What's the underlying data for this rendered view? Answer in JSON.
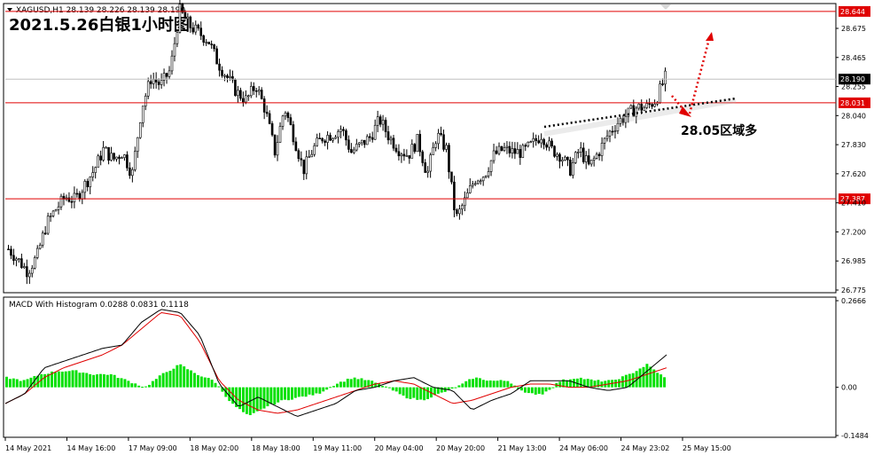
{
  "window": {
    "symbol_info": "XAGUSD,H1  28.139 28.226 28.139 28.190",
    "title": "2021.5.26白银1小时图"
  },
  "colors": {
    "background": "#ffffff",
    "candle": "#000000",
    "hline": "#e00000",
    "label_bg": "#e00000",
    "label_text": "#ffffff",
    "price_line": "#c0c0c0",
    "histogram": "#00e000",
    "macd_line": "#000000",
    "signal_line": "#e00000",
    "arrow": "#e00000",
    "grid_border": "#000000"
  },
  "annotation": {
    "text": "28.05区域多"
  },
  "chart_data": [
    {
      "type": "candlestick",
      "symbol": "XAGUSD",
      "timeframe": "H1",
      "title": "2021.5.26白银1小时图",
      "ylim": [
        26.775,
        28.685
      ],
      "y_ticks": [
        "28.675",
        "28.465",
        "28.255",
        "28.040",
        "27.830",
        "27.620",
        "27.410",
        "27.200",
        "26.985",
        "26.775"
      ],
      "x_ticks": [
        "14 May 2021",
        "14 May 16:00",
        "17 May 09:00",
        "18 May 02:00",
        "18 May 18:00",
        "19 May 11:00",
        "20 May 04:00",
        "20 May 20:00",
        "21 May 13:00",
        "24 May 06:00",
        "24 May 23:02",
        "25 May 15:00"
      ],
      "current_price": "28.190",
      "horizontal_levels": [
        {
          "label": "28.644",
          "value": 28.644
        },
        {
          "label": "28.031",
          "value": 28.031
        },
        {
          "label": "27.387",
          "value": 27.387
        }
      ],
      "trendline": {
        "from_value": 27.87,
        "to_value": 28.06,
        "style": "dotted"
      },
      "waypoints": [
        27.05,
        26.98,
        26.9,
        27.0,
        27.22,
        27.32,
        27.4,
        27.38,
        27.48,
        27.58,
        27.72,
        27.65,
        27.7,
        27.55,
        28.0,
        28.2,
        28.15,
        28.25,
        28.65,
        28.55,
        28.5,
        28.45,
        28.3,
        28.2,
        28.1,
        28.05,
        28.15,
        27.98,
        27.7,
        28.0,
        27.8,
        27.58,
        27.72,
        27.8,
        27.82,
        27.86,
        27.7,
        27.75,
        27.8,
        27.92,
        27.8,
        27.72,
        27.68,
        27.78,
        27.55,
        27.82,
        27.72,
        27.25,
        27.38,
        27.52,
        27.55,
        27.68,
        27.72,
        27.7,
        27.7,
        27.75,
        27.82,
        27.72,
        27.68,
        27.58,
        27.72,
        27.6,
        27.7,
        27.82,
        27.9,
        27.95,
        28.0,
        28.0,
        28.05,
        28.2
      ]
    },
    {
      "type": "macd",
      "title": "MACD With Histogram 0.0288 0.0831 0.1118",
      "ylim": [
        -0.1484,
        0.2666
      ],
      "y_ticks": [
        "0.2666",
        "0.00",
        "-0.1484"
      ],
      "histogram_waypoints": [
        0.03,
        0.02,
        0.04,
        0.05,
        0.05,
        0.04,
        0.04,
        0.02,
        0.0,
        0.04,
        0.07,
        0.04,
        0.02,
        -0.05,
        -0.09,
        -0.06,
        -0.04,
        -0.03,
        -0.02,
        0.01,
        0.03,
        0.02,
        0.0,
        -0.03,
        -0.04,
        -0.02,
        0.0,
        0.03,
        0.02,
        0.02,
        -0.02,
        -0.02,
        0.02,
        0.03,
        0.02,
        0.02,
        0.04,
        0.07,
        0.03
      ],
      "macd_waypoints": [
        -0.05,
        -0.02,
        0.06,
        0.08,
        0.1,
        0.12,
        0.13,
        0.2,
        0.24,
        0.23,
        0.16,
        0.01,
        -0.06,
        -0.03,
        -0.06,
        -0.09,
        -0.07,
        -0.05,
        -0.01,
        0.0,
        0.02,
        0.03,
        0.0,
        -0.01,
        -0.07,
        -0.04,
        -0.02,
        0.02,
        0.02,
        0.02,
        0.0,
        -0.01,
        0.0,
        0.05,
        0.1
      ],
      "signal_waypoints": [
        -0.05,
        -0.02,
        0.03,
        0.06,
        0.08,
        0.1,
        0.13,
        0.18,
        0.23,
        0.22,
        0.14,
        0.02,
        -0.04,
        -0.07,
        -0.08,
        -0.07,
        -0.05,
        -0.03,
        -0.01,
        0.01,
        0.02,
        0.01,
        -0.02,
        -0.05,
        -0.04,
        -0.02,
        0.0,
        0.01,
        0.01,
        0.0,
        0.0,
        0.01,
        0.02,
        0.04,
        0.06
      ]
    }
  ]
}
